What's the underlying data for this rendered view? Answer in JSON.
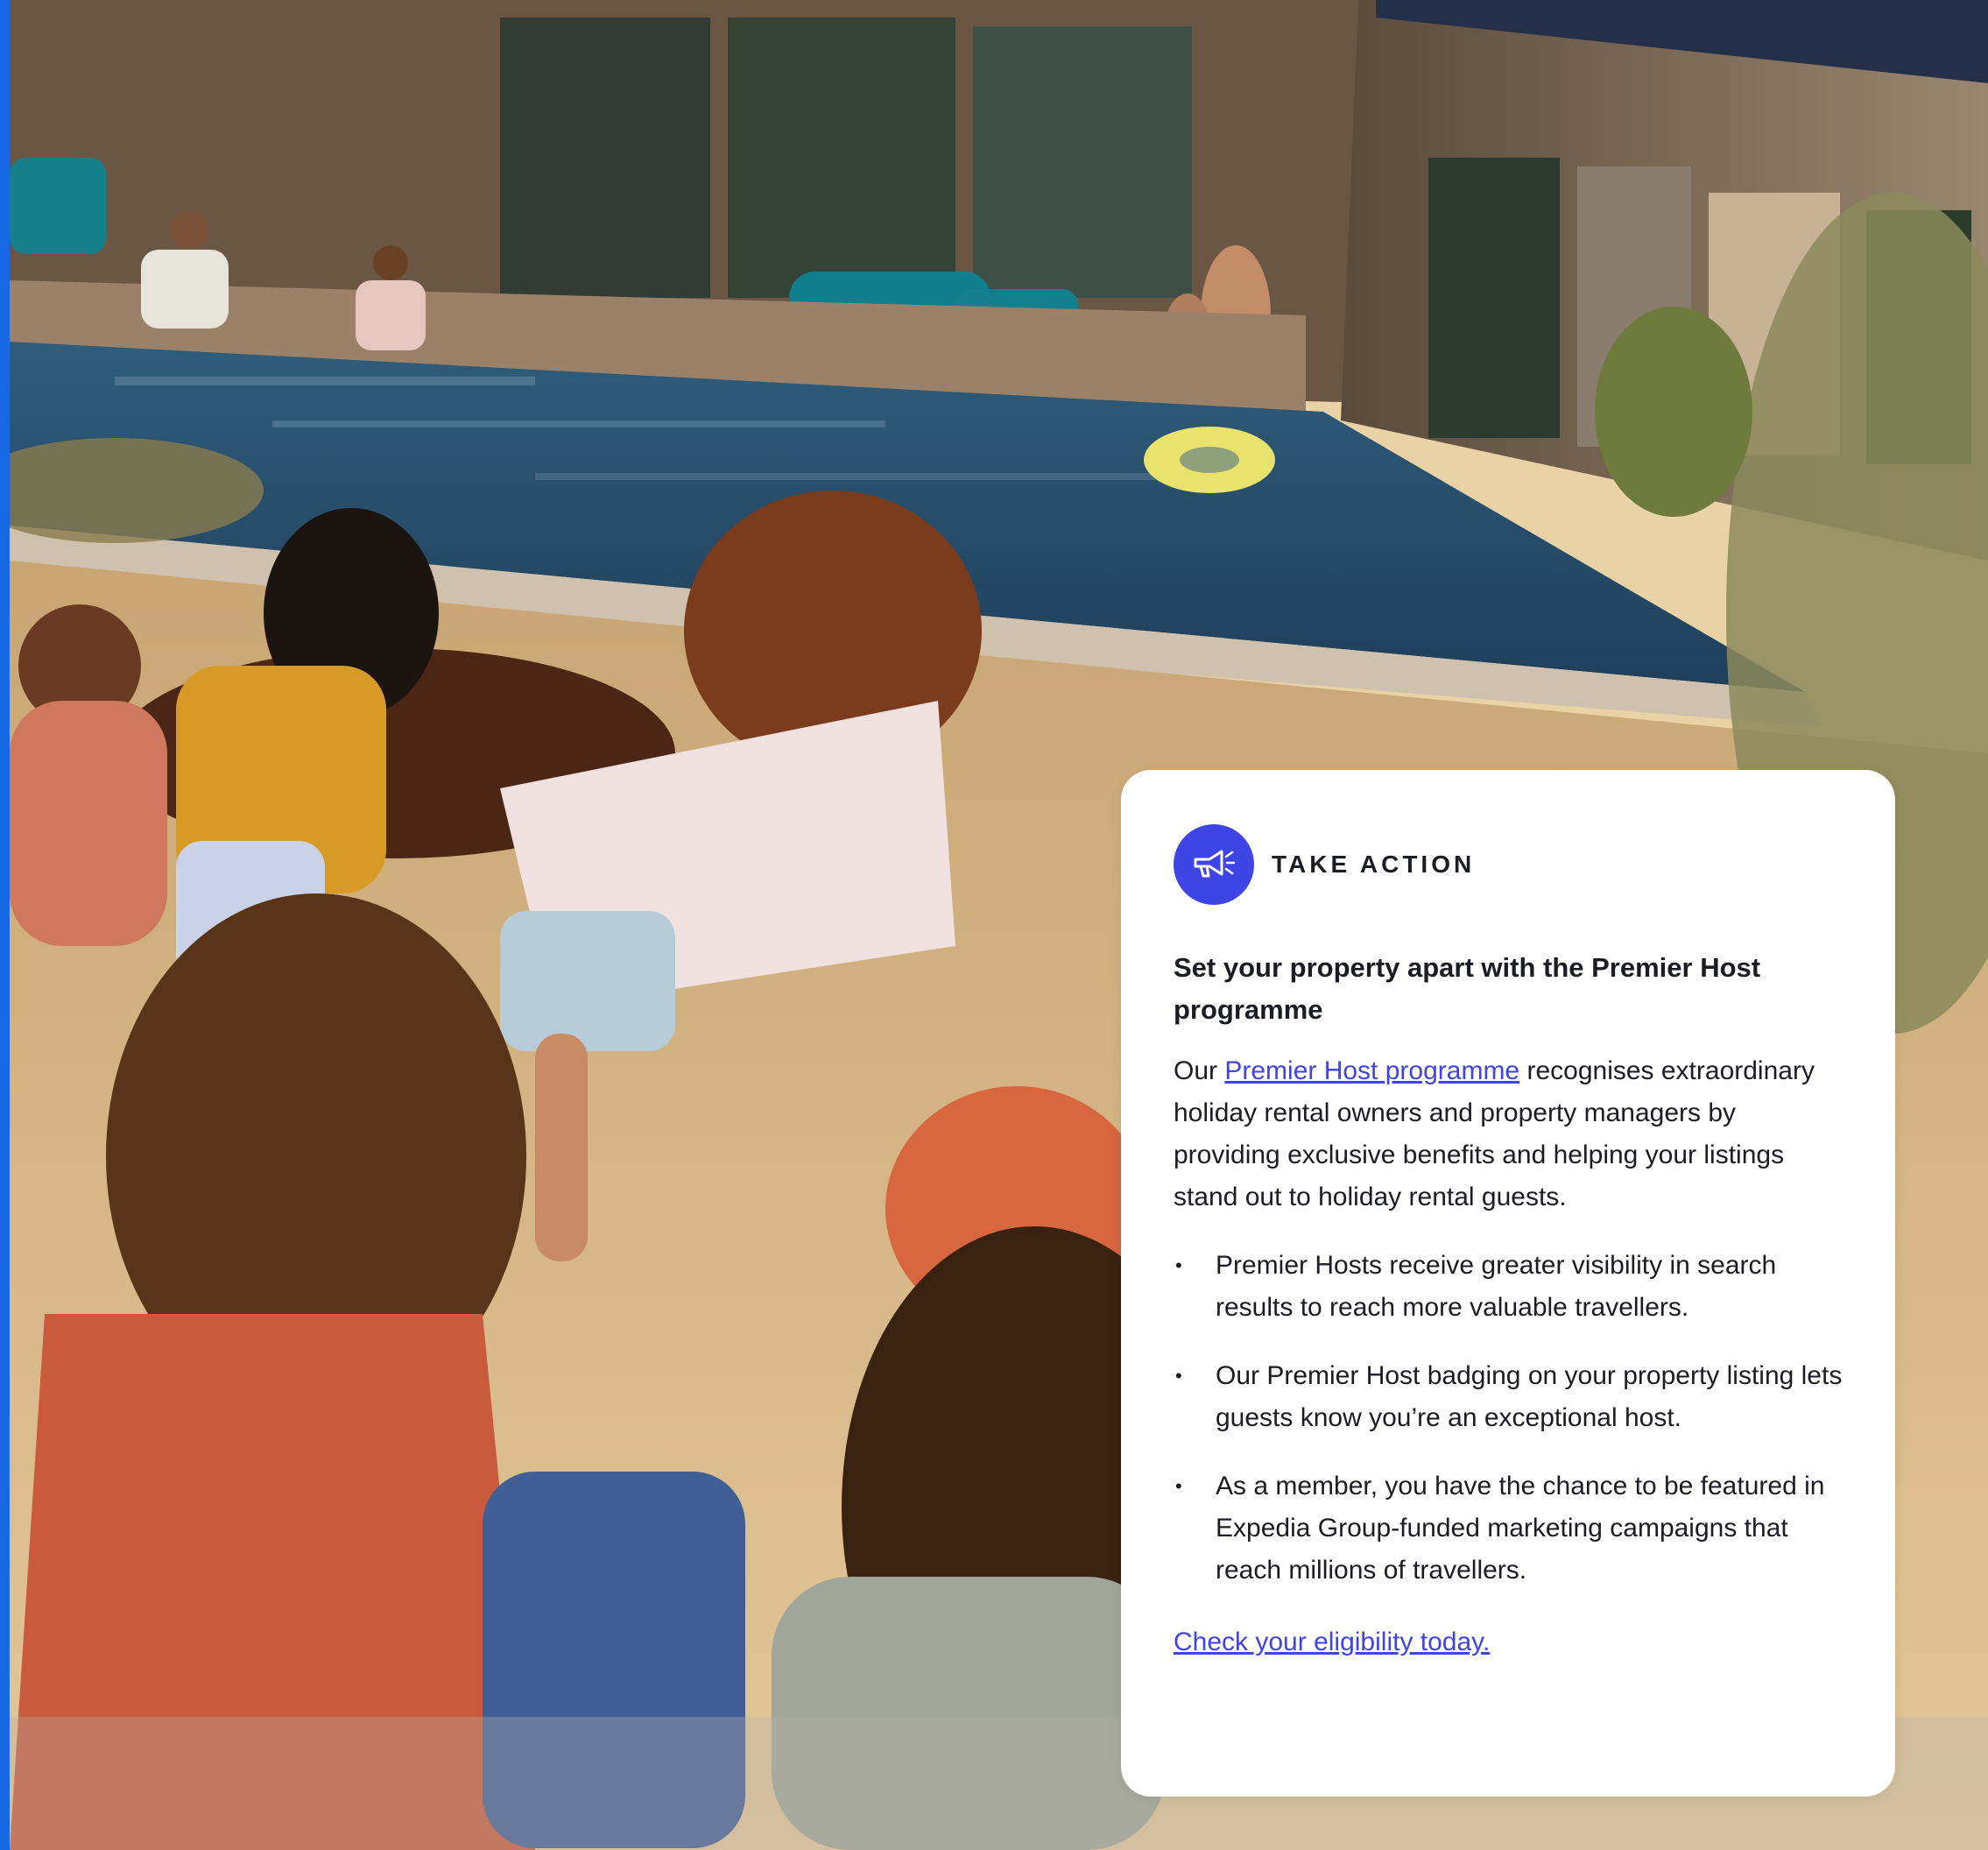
{
  "colors": {
    "accent_bar": "#1668e3",
    "brand_purple": "#3f44e6",
    "text_dark": "#1c1c24",
    "card_background": "#ffffff"
  },
  "hero": {
    "image_description_icon": "vacation-home-photo"
  },
  "card": {
    "icon": "megaphone-icon",
    "eyebrow": "TAKE ACTION",
    "title": "Set your property apart with the Premier Host programme",
    "intro_before_link": "Our ",
    "intro_link": "Premier Host programme",
    "intro_after_link": " recognises extraordinary holiday rental owners and property managers by providing exclusive benefits and helping your listings stand out to holiday rental guests.",
    "bullets": [
      "Premier Hosts receive greater visibility in search results to reach more valuable travellers.",
      "Our Premier Host badging on your property listing lets guests know you’re an exceptional host.",
      "As a member, you have the chance to be featured in Expedia Group-funded marketing campaigns that reach millions of travellers."
    ],
    "bullet_glyph": "•",
    "cta": "Check your eligibility today."
  }
}
